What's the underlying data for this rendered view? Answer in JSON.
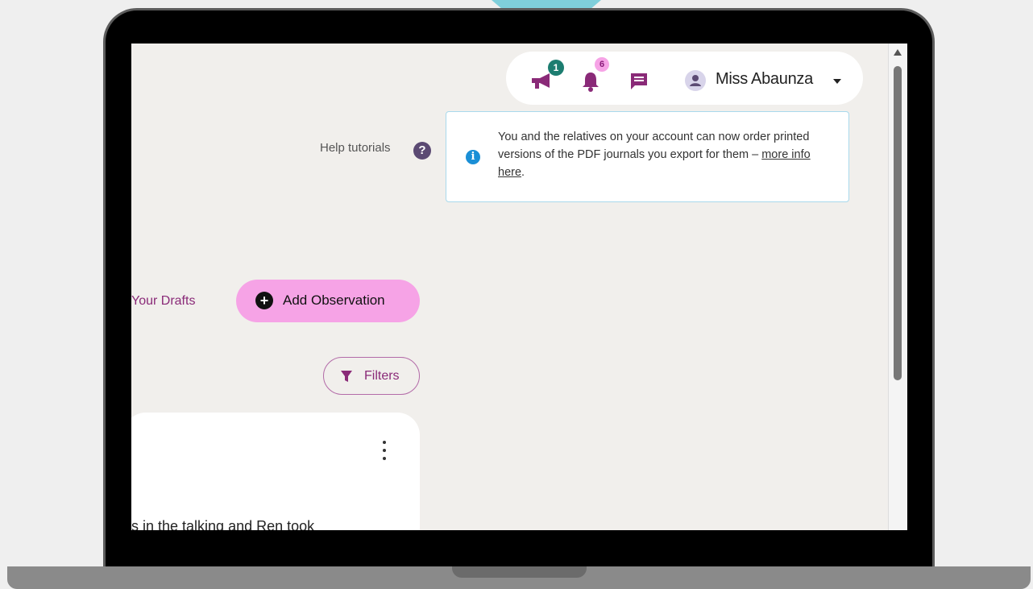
{
  "header": {
    "announcements_badge": "1",
    "notifications_badge": "6",
    "user_name": "Miss Abaunza"
  },
  "help": {
    "label": "Help tutorials",
    "icon_glyph": "?"
  },
  "notice": {
    "text": "You and the relatives on your account can now order printed versions of the PDF journals you export for them – ",
    "link_text": "more info here",
    "trailing": "."
  },
  "actions": {
    "drafts_label": "Your Drafts",
    "add_observation_label": "Add Observation",
    "filters_label": "Filters"
  },
  "card": {
    "snippet": "s in the talking and Ren took"
  },
  "colors": {
    "accent_pink": "#f6a3e6",
    "brand_purple": "#8a2a78",
    "badge_green": "#1c7d70",
    "info_blue": "#1a8fd6",
    "pointer_teal": "#7fcfdb"
  },
  "icons": {
    "announcements": "megaphone-icon",
    "notifications": "bell-icon",
    "messages": "chat-icon",
    "user": "user-avatar-icon",
    "help": "question-circle-icon",
    "info": "info-icon",
    "add": "plus-circle-icon",
    "filter": "funnel-icon",
    "more": "kebab-menu-icon"
  }
}
